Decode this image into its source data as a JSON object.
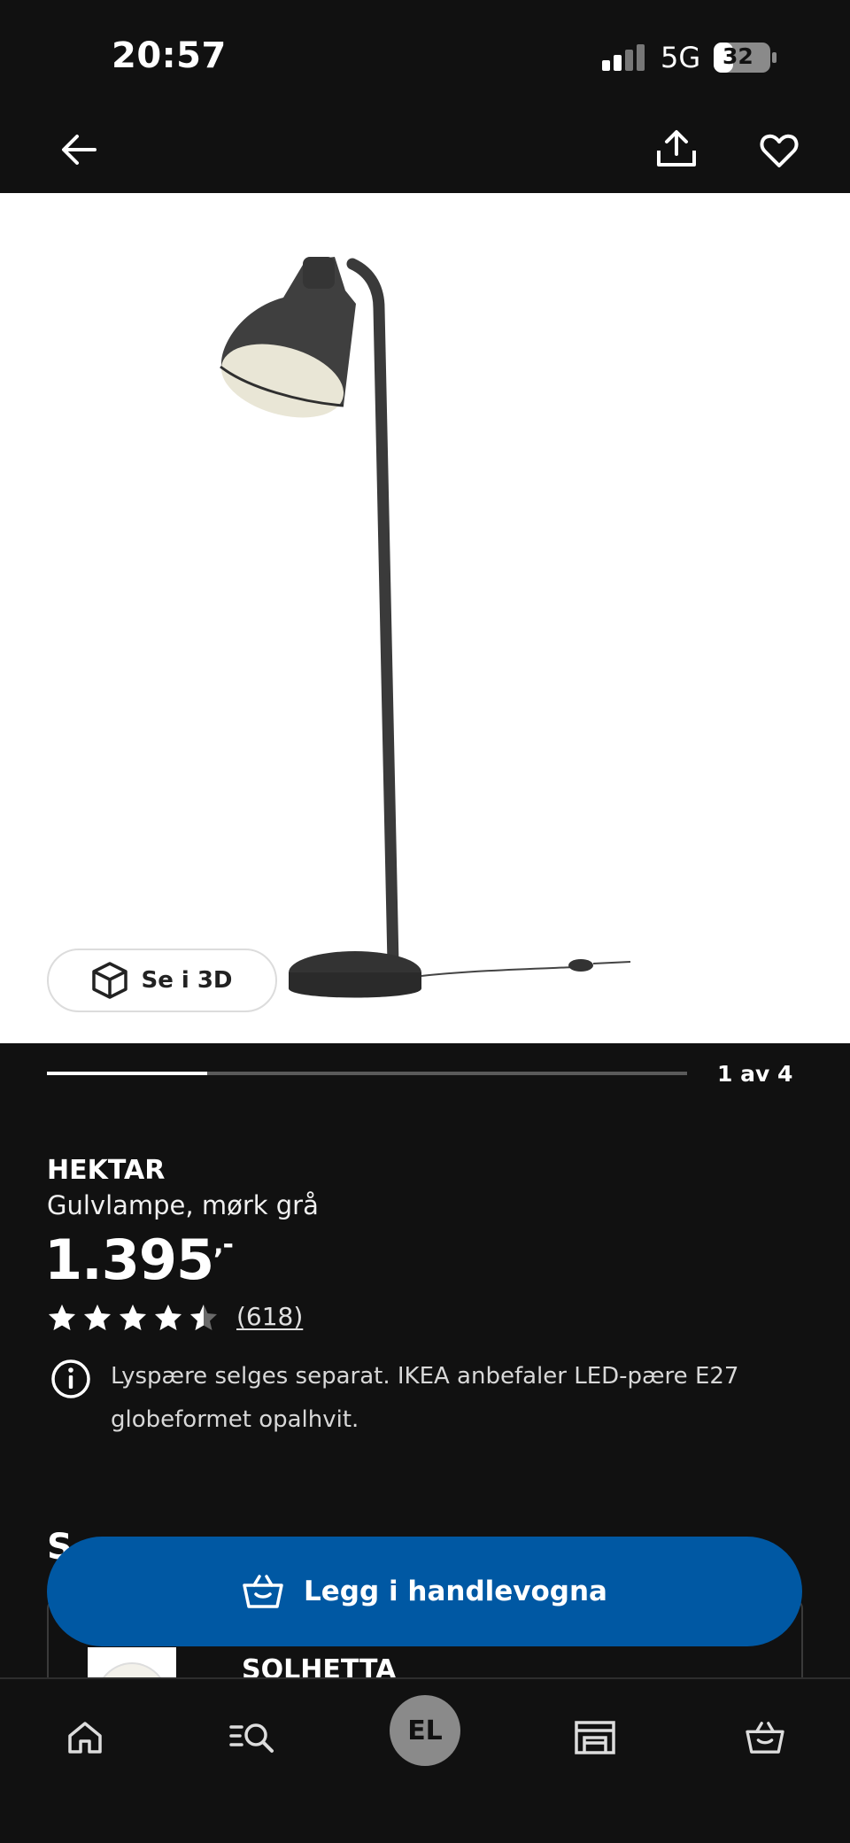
{
  "status_bar": {
    "time": "20:57",
    "network": "5G",
    "battery": "32"
  },
  "appbar": {
    "back_icon": "arrow-left-icon",
    "share_icon": "share-icon",
    "favorite_icon": "heart-icon"
  },
  "gallery": {
    "view_3d_label": "Se i 3D",
    "counter": "1 av 4",
    "progress": 0.25
  },
  "product": {
    "name": "HEKTAR",
    "description": "Gulvlampe, mørk grå",
    "price": "1.395",
    "price_suffix": ",-",
    "rating": 4.5,
    "review_count": "(618)",
    "info_text": "Lyspære selges separat. IKEA anbefaler LED-pære E27 globeformet opalhvit."
  },
  "related": {
    "section_title": "S",
    "item_name": "SOLHETTA"
  },
  "cta": {
    "label": "Legg i handlevogna"
  },
  "bottom_nav": {
    "items": [
      "home-icon",
      "search-icon",
      "profile-avatar",
      "store-icon",
      "cart-icon"
    ],
    "avatar_initials": "EL"
  },
  "colors": {
    "background": "#111111",
    "cta_blue": "#0058a3",
    "text": "#ffffff"
  }
}
